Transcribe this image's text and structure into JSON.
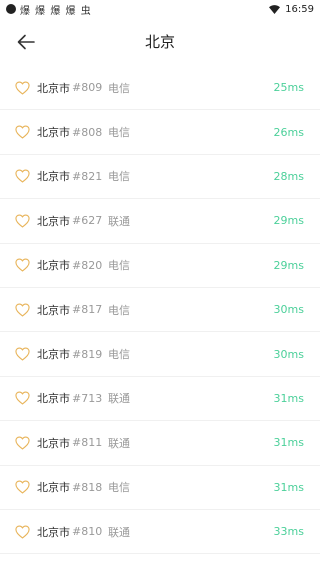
{
  "status": {
    "left_icons": "爆 爆 爆 爆 虫",
    "time": "16:59"
  },
  "header": {
    "title": "北京"
  },
  "colors": {
    "accent_green": "#4cd09a",
    "heart": "#e8b45a"
  },
  "servers": [
    {
      "city": "北京市",
      "num": "#809",
      "isp": "电信",
      "ping": "25ms"
    },
    {
      "city": "北京市",
      "num": "#808",
      "isp": "电信",
      "ping": "26ms"
    },
    {
      "city": "北京市",
      "num": "#821",
      "isp": "电信",
      "ping": "28ms"
    },
    {
      "city": "北京市",
      "num": "#627",
      "isp": "联通",
      "ping": "29ms"
    },
    {
      "city": "北京市",
      "num": "#820",
      "isp": "电信",
      "ping": "29ms"
    },
    {
      "city": "北京市",
      "num": "#817",
      "isp": "电信",
      "ping": "30ms"
    },
    {
      "city": "北京市",
      "num": "#819",
      "isp": "电信",
      "ping": "30ms"
    },
    {
      "city": "北京市",
      "num": "#713",
      "isp": "联通",
      "ping": "31ms"
    },
    {
      "city": "北京市",
      "num": "#811",
      "isp": "联通",
      "ping": "31ms"
    },
    {
      "city": "北京市",
      "num": "#818",
      "isp": "电信",
      "ping": "31ms"
    },
    {
      "city": "北京市",
      "num": "#810",
      "isp": "联通",
      "ping": "33ms"
    }
  ]
}
